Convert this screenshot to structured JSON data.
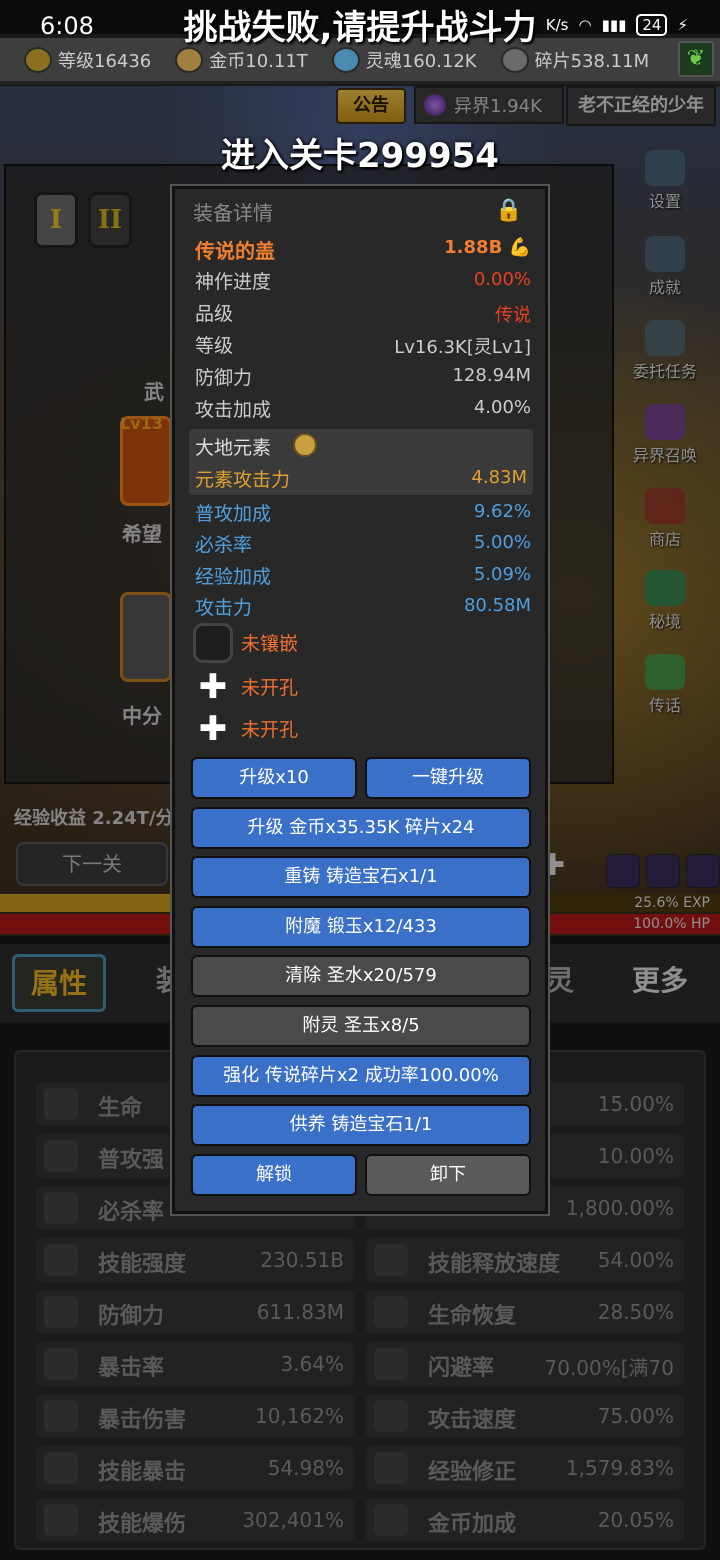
{
  "status": {
    "time": "6:08",
    "battery": "24",
    "net": "K/s"
  },
  "toasts": {
    "fail": "挑战失败,请提升战斗力",
    "enter": "进入关卡299954"
  },
  "resources": [
    {
      "label": "等级16436"
    },
    {
      "label": "金币10.11T"
    },
    {
      "label": "灵魂160.12K"
    },
    {
      "label": "碎片538.11M"
    }
  ],
  "header": {
    "notice": "公告",
    "realm": "异界1.94K",
    "player_name": "老不正经的少年"
  },
  "background": {
    "tier1": "I",
    "tier2": "II",
    "weapon_label_partial": "武",
    "slot_a_level": "Lv13",
    "slot_a_name": "希望",
    "slot_b_name": "中分",
    "exp_income": "经验收益 2.24T/分",
    "next_stage": "下一关",
    "exp_bar_text": "25.6% EXP",
    "exp_progress": 0.256,
    "hp_bar_text": "100.0%  HP",
    "hp_progress": 1.0
  },
  "side_menu": [
    {
      "label": "设置",
      "icon": "gear-icon"
    },
    {
      "label": "成就",
      "icon": "star-icon"
    },
    {
      "label": "委托任务",
      "icon": "quest-icon"
    },
    {
      "label": "异界召唤",
      "icon": "portal-icon"
    },
    {
      "label": "商店",
      "icon": "shop-icon"
    },
    {
      "label": "秘境",
      "icon": "orb-icon"
    },
    {
      "label": "传话",
      "icon": "horn-icon"
    }
  ],
  "tabs": {
    "attributes": "属性",
    "equipment": "装",
    "spirit": "灵",
    "more": "更多"
  },
  "stats": [
    {
      "name": "生命",
      "value": "15.00%",
      "icon": "cross-icon"
    },
    {
      "name": "普攻强",
      "value": "10.00%",
      "icon": "sword-icon"
    },
    {
      "name": "必杀率",
      "value": "1,800.00%",
      "icon": "crit-icon"
    },
    {
      "name": "技能强度",
      "value": "230.51B",
      "icon": "lightning-icon"
    },
    {
      "name": "技能释放速度",
      "value": "54.00%",
      "icon": "flame-icon"
    },
    {
      "name": "防御力",
      "value": "611.83M",
      "icon": "shield-icon"
    },
    {
      "name": "生命恢复",
      "value": "28.50%",
      "icon": "regen-icon"
    },
    {
      "name": "暴击率",
      "value": "3.64%",
      "icon": "claw-icon"
    },
    {
      "name": "闪避率",
      "value": "70.00%[满70",
      "icon": "boot-icon"
    },
    {
      "name": "暴击伤害",
      "value": "10,162%",
      "icon": "claw-icon"
    },
    {
      "name": "攻击速度",
      "value": "75.00%",
      "icon": "swords-icon"
    },
    {
      "name": "技能暴击",
      "value": "54.98%",
      "icon": "blue-flame-icon"
    },
    {
      "name": "经验修正",
      "value": "1,579.83%",
      "icon": "crown-icon"
    },
    {
      "name": "技能爆伤",
      "value": "302,401%",
      "icon": "blue-flame-icon"
    },
    {
      "name": "金币加成",
      "value": "20.05%",
      "icon": "coin-icon"
    }
  ],
  "dialog": {
    "title": "装备详情",
    "item_name": "传说的盖",
    "power": "1.88B",
    "rows": [
      {
        "k": "神作进度",
        "v": "0.00%"
      },
      {
        "k": "品级",
        "v": "传说"
      },
      {
        "k": "等级",
        "v": "Lv16.3K[灵Lv1]"
      },
      {
        "k": "防御力",
        "v": "128.94M"
      },
      {
        "k": "攻击加成",
        "v": "4.00%"
      }
    ],
    "element": {
      "title": "大地元素",
      "k": "元素攻击力",
      "v": "4.83M"
    },
    "affixes": [
      {
        "k": "普攻加成",
        "v": "9.62%"
      },
      {
        "k": "必杀率",
        "v": "5.00%"
      },
      {
        "k": "经验加成",
        "v": "5.09%"
      },
      {
        "k": "攻击力",
        "v": "80.58M"
      }
    ],
    "sockets": [
      "未镶嵌",
      "未开孔",
      "未开孔"
    ],
    "buttons": {
      "upgrade10": "升级x10",
      "oneclick": "一键升级",
      "upgrade": "升级 金币x35.35K 碎片x24",
      "reforge": "重铸 铸造宝石x1/1",
      "enchant": "附魔 锻玉x12/433",
      "clear": "清除 圣水x20/579",
      "spirit": "附灵 圣玉x8/5",
      "strengthen": "强化 传说碎片x2 成功率100.00%",
      "nurture": "供养 铸造宝石1/1",
      "unlock": "解锁",
      "unequip": "卸下"
    }
  }
}
